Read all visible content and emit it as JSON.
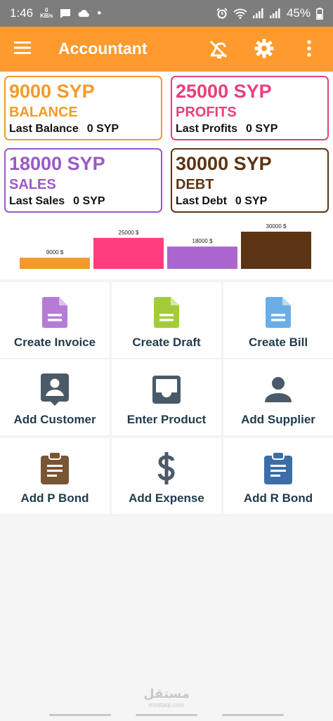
{
  "status_bar": {
    "time": "1:46",
    "speed_value": "0",
    "speed_unit": "KB/s",
    "dot": "•",
    "battery": "45%"
  },
  "app_bar": {
    "title": "Accountant"
  },
  "stats": [
    {
      "amount": "9000 SYP",
      "label": "BALANCE",
      "last_label": "Last Balance",
      "last_value": "0 SYP",
      "color": "#f39a2a"
    },
    {
      "amount": "25000 SYP",
      "label": "PROFITS",
      "last_label": "Last Profits",
      "last_value": "0 SYP",
      "color": "#e8407a"
    },
    {
      "amount": "18000 SYP",
      "label": "SALES",
      "last_label": "Last Sales",
      "last_value": "0 SYP",
      "color": "#9b59c8"
    },
    {
      "amount": "30000 SYP",
      "label": "DEBT",
      "last_label": "Last Debt",
      "last_value": "0 SYP",
      "color": "#5c3413"
    }
  ],
  "chart_data": {
    "type": "bar",
    "categories": [
      "",
      "",
      "",
      ""
    ],
    "values": [
      9000,
      25000,
      18000,
      30000
    ],
    "data_labels": [
      "9000 $",
      "25000 $",
      "18000 $",
      "30000 $"
    ],
    "colors": [
      "#f39a2a",
      "#ff3d7f",
      "#aa66cc",
      "#5c3413"
    ],
    "ylim": [
      0,
      30000
    ]
  },
  "actions": [
    {
      "label": "Create Invoice",
      "icon": "invoice-file-icon",
      "color": "#b57bd6"
    },
    {
      "label": "Create Draft",
      "icon": "draft-file-icon",
      "color": "#a4cc3a"
    },
    {
      "label": "Create Bill",
      "icon": "bill-file-icon",
      "color": "#6aaee6"
    },
    {
      "label": "Add Customer",
      "icon": "customer-contact-icon",
      "color": "#4a5a68"
    },
    {
      "label": "Enter Product",
      "icon": "product-inbox-icon",
      "color": "#4a5a68"
    },
    {
      "label": "Add Supplier",
      "icon": "supplier-person-icon",
      "color": "#4a5a68"
    },
    {
      "label": "Add P Bond",
      "icon": "p-bond-clipboard-icon",
      "color": "#7a5533"
    },
    {
      "label": "Add Expense",
      "icon": "expense-dollar-icon",
      "color": "#4a5a68"
    },
    {
      "label": "Add R Bond",
      "icon": "r-bond-clipboard-icon",
      "color": "#3b6ea6"
    }
  ],
  "watermark": {
    "arabic": "مستقل",
    "latin": "mostaql.com"
  }
}
